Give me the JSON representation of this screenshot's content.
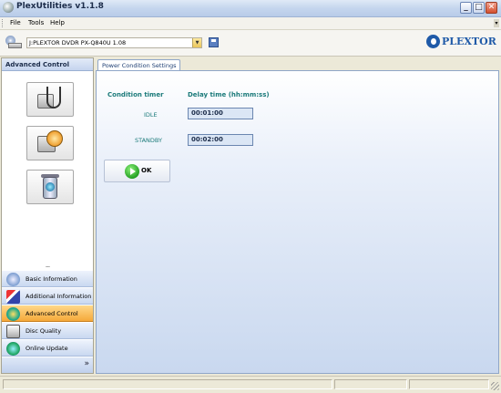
{
  "window": {
    "title": "PlexUtilities v1.1.8",
    "controls": {
      "minimize": "_",
      "maximize": "□",
      "close": "✕"
    }
  },
  "menu": {
    "items": [
      "File",
      "Tools",
      "Help"
    ]
  },
  "toolbar": {
    "drive_value": "J:PLEXTOR DVDR   PX-Q840U  1.08",
    "brand": "PLEXTOR"
  },
  "sidebar": {
    "header": "Advanced Control",
    "tools": [
      {
        "icon": "stethoscope-drive-icon"
      },
      {
        "icon": "speed-gauge-drive-icon"
      },
      {
        "icon": "recycle-bin-icon"
      }
    ],
    "splitter": "........",
    "nav": [
      {
        "label": "Basic Information",
        "icon": "info-icon",
        "active": false
      },
      {
        "label": "Additional Information",
        "icon": "additional-info-icon",
        "active": false
      },
      {
        "label": "Advanced Control",
        "icon": "advanced-control-icon",
        "active": true
      },
      {
        "label": "Disc Quality",
        "icon": "disc-quality-icon",
        "active": false
      },
      {
        "label": "Online Update",
        "icon": "globe-icon",
        "active": false
      }
    ],
    "footer_chevron": "»"
  },
  "main": {
    "tab": "Power Condition Settings",
    "headers": {
      "timer": "Condition timer",
      "delay": "Delay time (hh:mm:ss)"
    },
    "rows": [
      {
        "label": "IDLE",
        "value": "00:01:00"
      },
      {
        "label": "STANDBY",
        "value": "00:02:00"
      }
    ],
    "ok_label": "OK"
  },
  "colors": {
    "accent": "#1b7a7a",
    "active_nav": "#f5a93a",
    "brand": "#1f5aa8"
  }
}
